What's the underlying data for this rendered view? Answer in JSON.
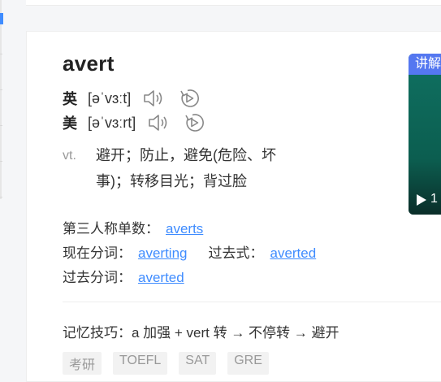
{
  "entry": {
    "word": "avert",
    "pronunciations": [
      {
        "lang": "英",
        "ipa": "[əˈvɜːt]"
      },
      {
        "lang": "美",
        "ipa": "[əˈvɜːrt]"
      }
    ],
    "definition": {
      "pos": "vt.",
      "text": "避开；防止，避免(危险、坏事)；转移目光；背过脸"
    },
    "forms": {
      "third_person_label": "第三人称单数：",
      "third_person_value": "averts",
      "present_participle_label": "现在分词：",
      "present_participle_value": "averting",
      "past_tense_label": "过去式：",
      "past_tense_value": "averted",
      "past_participle_label": "过去分词：",
      "past_participle_value": "averted"
    },
    "memory_tip": "记忆技巧：a 加强 + vert 转 → 不停转 → 避开",
    "tags": [
      "考研",
      "TOEFL",
      "SAT",
      "GRE"
    ]
  },
  "video_panel": {
    "tab_label": "讲解",
    "count_text": "1",
    "accent_color": "#5477f0"
  },
  "colors": {
    "link": "#3f8cff",
    "tag_bg": "#f2f2f2",
    "page_bg": "#f5f6f8"
  }
}
